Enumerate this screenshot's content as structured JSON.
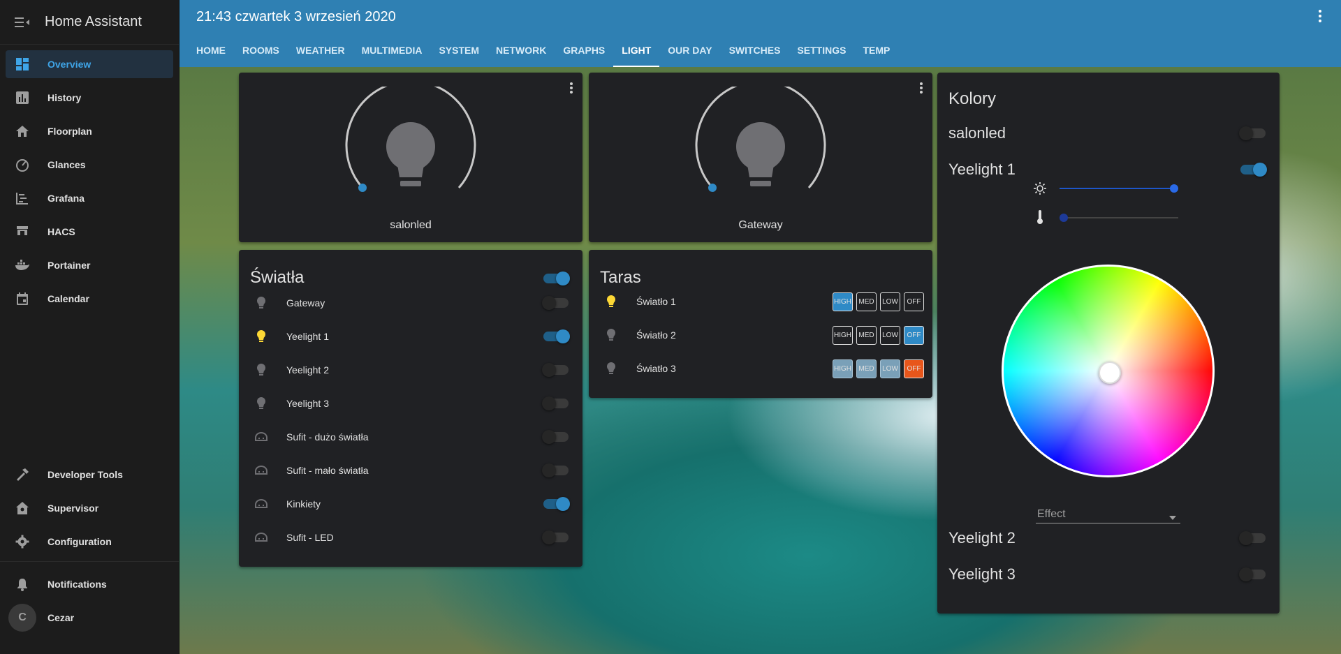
{
  "app": {
    "title": "Home Assistant"
  },
  "sidebar": {
    "items": [
      {
        "label": "Overview"
      },
      {
        "label": "History"
      },
      {
        "label": "Floorplan"
      },
      {
        "label": "Glances"
      },
      {
        "label": "Grafana"
      },
      {
        "label": "HACS"
      },
      {
        "label": "Portainer"
      },
      {
        "label": "Calendar"
      }
    ],
    "bottom": [
      {
        "label": "Developer Tools"
      },
      {
        "label": "Supervisor"
      },
      {
        "label": "Configuration"
      },
      {
        "label": "Notifications"
      },
      {
        "label": "Cezar"
      }
    ],
    "avatar_initial": "C"
  },
  "header": {
    "datetime": "21:43 czwartek 3 wrzesień 2020",
    "tabs": [
      "HOME",
      "ROOMS",
      "WEATHER",
      "MULTIMEDIA",
      "SYSTEM",
      "NETWORK",
      "GRAPHS",
      "LIGHT",
      "OUR DAY",
      "SWITCHES",
      "SETTINGS",
      "TEMP"
    ],
    "active_tab": "LIGHT"
  },
  "light_cards": [
    {
      "name": "salonled",
      "brightness": 0
    },
    {
      "name": "Gateway",
      "brightness": 0
    }
  ],
  "swiatla": {
    "title": "Światła",
    "master_on": true,
    "rows": [
      {
        "name": "Gateway",
        "icon": "bulb-icon",
        "on": false
      },
      {
        "name": "Yeelight 1",
        "icon": "bulb-icon",
        "on": true
      },
      {
        "name": "Yeelight 2",
        "icon": "bulb-icon",
        "on": false
      },
      {
        "name": "Yeelight 3",
        "icon": "bulb-icon",
        "on": false
      },
      {
        "name": "Sufit - dużo światła",
        "icon": "ceiling-light-icon",
        "on": false
      },
      {
        "name": "Sufit - mało światła",
        "icon": "ceiling-light-icon",
        "on": false
      },
      {
        "name": "Kinkiety",
        "icon": "ceiling-light-icon",
        "on": true
      },
      {
        "name": "Sufit - LED",
        "icon": "ceiling-light-icon",
        "on": false
      }
    ]
  },
  "taras": {
    "title": "Taras",
    "buttons": [
      "HIGH",
      "MED",
      "LOW",
      "OFF"
    ],
    "rows": [
      {
        "name": "Światło 1",
        "on": true,
        "active": "HIGH"
      },
      {
        "name": "Światło 2",
        "on": false,
        "active": "OFF"
      },
      {
        "name": "Światło 3",
        "on": false,
        "active": "OFF"
      }
    ]
  },
  "kolory": {
    "title": "Kolory",
    "lights": [
      {
        "name": "salonled",
        "on": false
      },
      {
        "name": "Yeelight 1",
        "on": true
      },
      {
        "name": "Yeelight 2",
        "on": false
      },
      {
        "name": "Yeelight 3",
        "on": false
      }
    ],
    "brightness_fraction": 1.0,
    "color_temp_fraction": 0.0,
    "effect_label": "Effect"
  },
  "colors": {
    "header": "#2f80b3",
    "accent": "#2f8ac6",
    "card": "#202124",
    "bulb_on": "#fdd835",
    "bulb_off": "#6f6f73",
    "off_button": "#e8561b"
  }
}
